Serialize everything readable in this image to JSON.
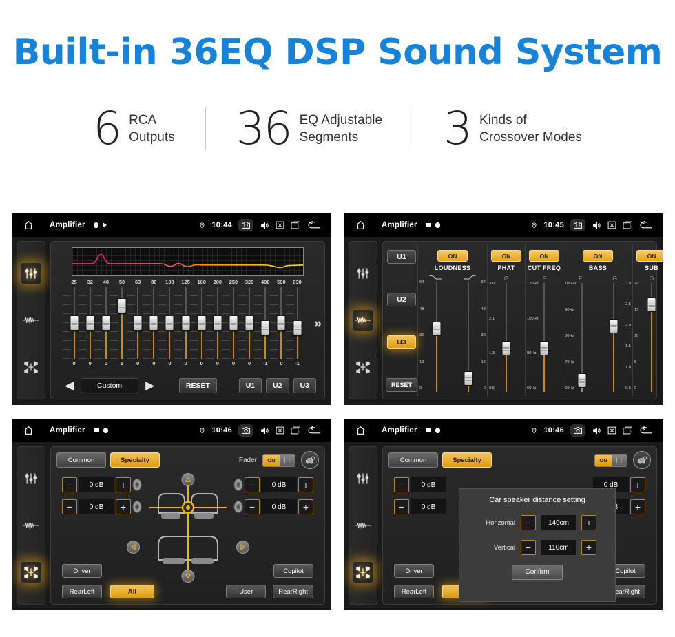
{
  "headline": "Built-in 36EQ DSP Sound System",
  "stats": [
    {
      "number": "6",
      "text": "RCA\nOutputs"
    },
    {
      "number": "36",
      "text": "EQ Adjustable\nSegments"
    },
    {
      "number": "3",
      "text": "Kinds of\nCrossover Modes"
    }
  ],
  "colors": {
    "headline_blue": "#1683d8",
    "accent_amber": "#e2a01b",
    "screen_bg": "#1a1a1a"
  },
  "panels": {
    "eq": {
      "statusbar": {
        "title": "Amplifier",
        "time": "10:44"
      },
      "frequencies": [
        "25",
        "32",
        "40",
        "50",
        "63",
        "80",
        "100",
        "125",
        "160",
        "200",
        "250",
        "320",
        "400",
        "500",
        "630"
      ],
      "values": [
        "0",
        "0",
        "0",
        "5",
        "0",
        "0",
        "0",
        "0",
        "0",
        "0",
        "0",
        "0",
        "-1",
        "0",
        "-1"
      ],
      "preset": "Custom",
      "reset_label": "RESET",
      "user_buttons": [
        "U1",
        "U2",
        "U3"
      ],
      "more_label": "»"
    },
    "crossover": {
      "statusbar": {
        "title": "Amplifier",
        "time": "10:45"
      },
      "presets": [
        "U1",
        "U2",
        "U3"
      ],
      "active_preset": "U3",
      "reset_label": "RESET",
      "columns": [
        {
          "name": "LOUDNESS",
          "state": "ON",
          "subs": [
            "",
            ""
          ],
          "sliders": [
            {
              "labels_left": [
                "64",
                "48",
                "32",
                "16",
                "0"
              ],
              "labels_right": [],
              "pos": 45
            },
            {
              "labels_left": [],
              "labels_right": [
                "64",
                "48",
                "32",
                "16",
                "0"
              ],
              "pos": 90
            }
          ]
        },
        {
          "name": "PHAT",
          "state": "ON",
          "subs": [
            "G"
          ],
          "sliders": [
            {
              "labels_left": [
                "3.0",
                "2.1",
                "1.3",
                "0.5"
              ],
              "labels_right": [],
              "pos": 62
            }
          ]
        },
        {
          "name": "CUT FREQ",
          "state": "ON",
          "subs": [
            "F"
          ],
          "sliders": [
            {
              "labels_left": [
                "120Hz",
                "100Hz",
                "80Hz",
                "60Hz"
              ],
              "labels_right": [],
              "pos": 62
            }
          ]
        },
        {
          "name": "BASS",
          "state": "ON",
          "subs": [
            "F",
            "G"
          ],
          "sliders": [
            {
              "labels_left": [
                "100Hz",
                "90Hz",
                "80Hz",
                "70Hz",
                "60Hz"
              ],
              "labels_right": [],
              "pos": 92
            },
            {
              "labels_left": [],
              "labels_right": [
                "3.0",
                "2.5",
                "2.0",
                "1.5",
                "1.0",
                "0.5"
              ],
              "pos": 42
            }
          ]
        },
        {
          "name": "SUB",
          "state": "ON",
          "subs": [
            "G"
          ],
          "sliders": [
            {
              "labels_left": [
                "20",
                "15",
                "10",
                "5",
                "0"
              ],
              "labels_right": [],
              "pos": 22
            }
          ]
        }
      ]
    },
    "fader": {
      "statusbar": {
        "title": "Amplifier",
        "time": "10:46"
      },
      "tabs": [
        {
          "label": "Common",
          "active": false
        },
        {
          "label": "Specialty",
          "active": true
        }
      ],
      "fader_label": "Fader",
      "fader_state": "ON",
      "levels": [
        {
          "side": "left",
          "value": "0 dB"
        },
        {
          "side": "left",
          "value": "0 dB"
        },
        {
          "side": "right",
          "value": "0 dB"
        },
        {
          "side": "right",
          "value": "0 dB"
        }
      ],
      "position_buttons": [
        {
          "label": "Driver",
          "active": false
        },
        {
          "label": "Copilot",
          "active": false
        },
        {
          "label": "RearLeft",
          "active": false
        },
        {
          "label": "All",
          "active": true
        },
        {
          "label": "User",
          "active": false
        },
        {
          "label": "RearRight",
          "active": false
        }
      ],
      "minus": "−",
      "plus": "+"
    },
    "dialog": {
      "statusbar": {
        "title": "Amplifier",
        "time": "10:46"
      },
      "title": "Car speaker distance setting",
      "rows": [
        {
          "label": "Horizontal",
          "value": "140cm"
        },
        {
          "label": "Vertical",
          "value": "110cm"
        }
      ],
      "confirm_label": "Confirm"
    }
  }
}
